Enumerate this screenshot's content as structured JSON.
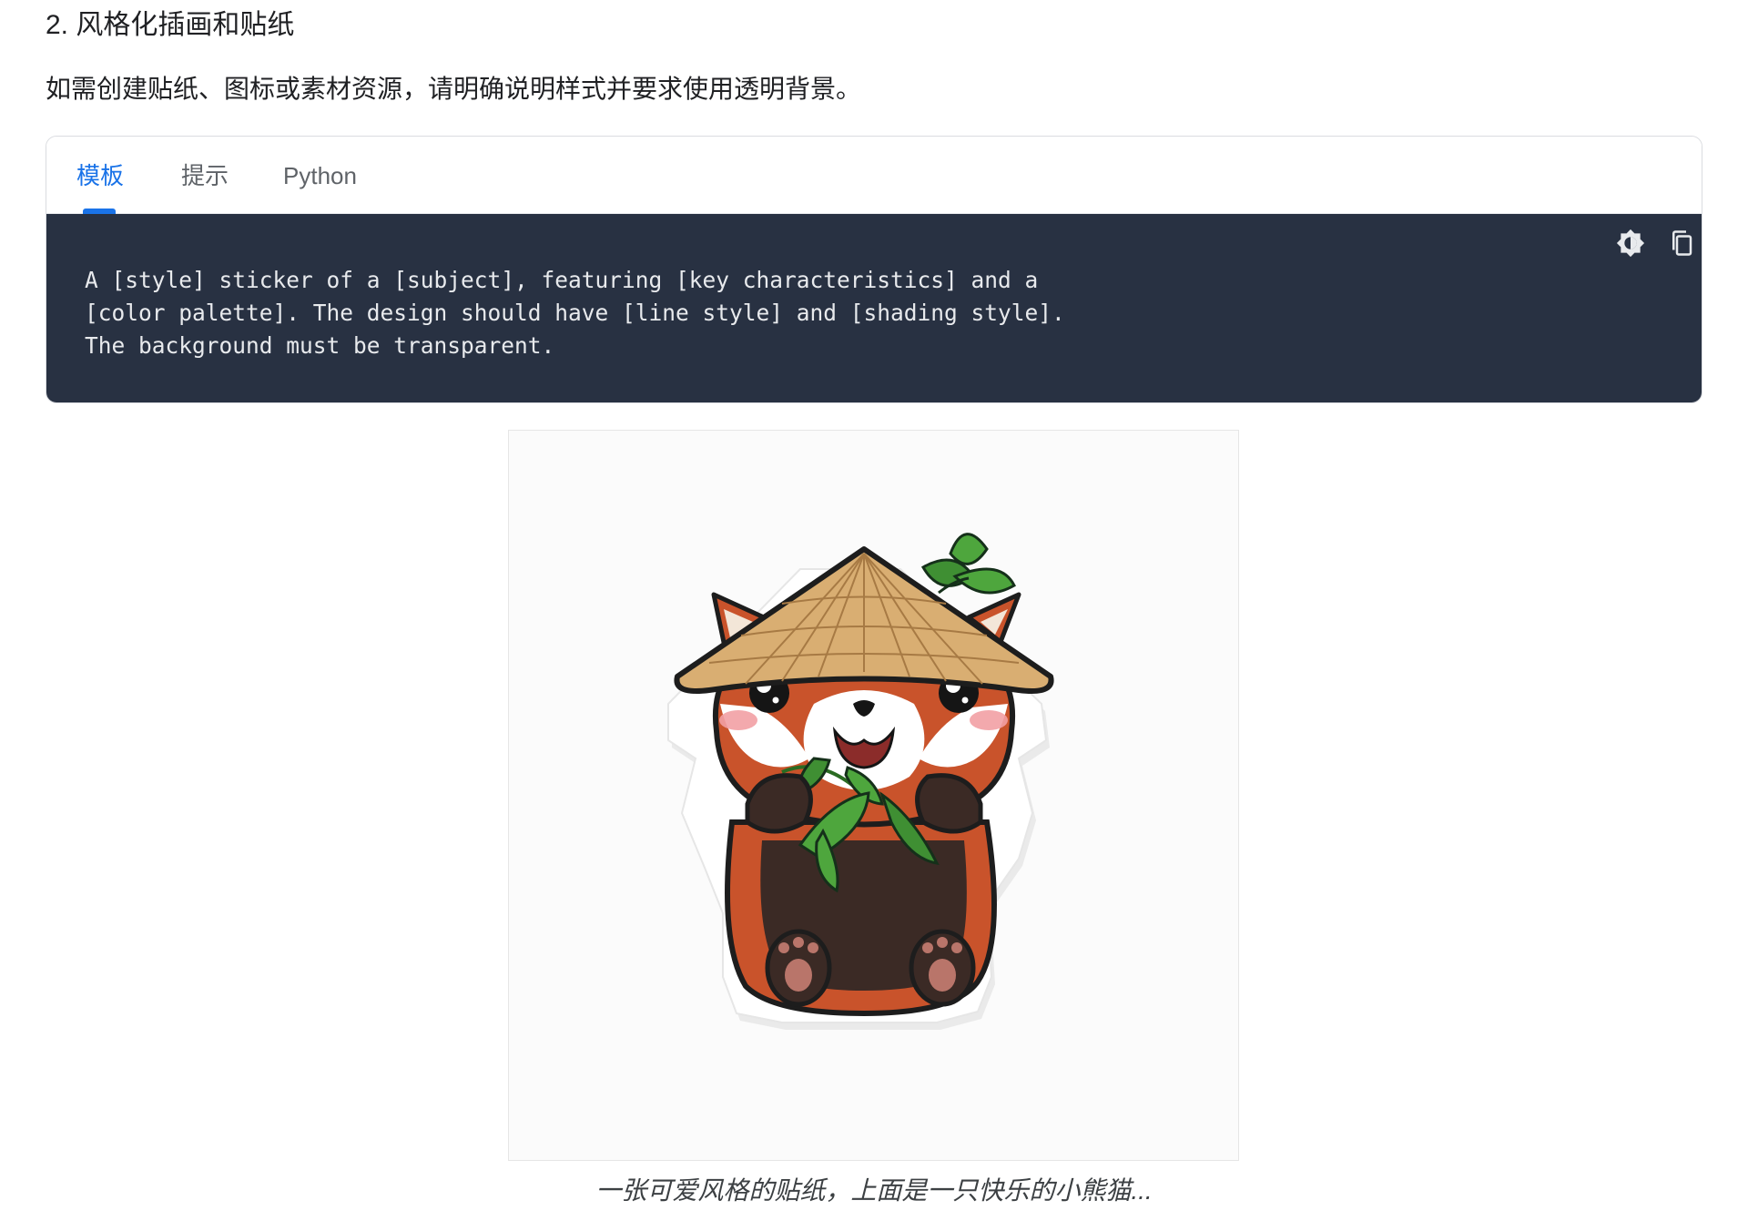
{
  "section": {
    "heading": "2. 风格化插画和贴纸",
    "description": "如需创建贴纸、图标或素材资源，请明确说明样式并要求使用透明背景。"
  },
  "code_block": {
    "tabs": [
      {
        "label": "模板",
        "active": true
      },
      {
        "label": "提示",
        "active": false
      },
      {
        "label": "Python",
        "active": false
      }
    ],
    "code_lines": [
      "A [style] sticker of a [subject], featuring [key characteristics] and a",
      "[color palette]. The design should have [line style] and [shading style].",
      "The background must be transparent."
    ],
    "toolbar": {
      "theme_toggle_icon": "brightness-contrast-icon",
      "copy_icon": "copy-icon"
    },
    "colors": {
      "background": "#283142",
      "text": "#e8eaed",
      "active_tab": "#1a73e8"
    }
  },
  "figure": {
    "caption": "一张可爱风格的贴纸，上面是一只快乐的小熊猫..."
  }
}
